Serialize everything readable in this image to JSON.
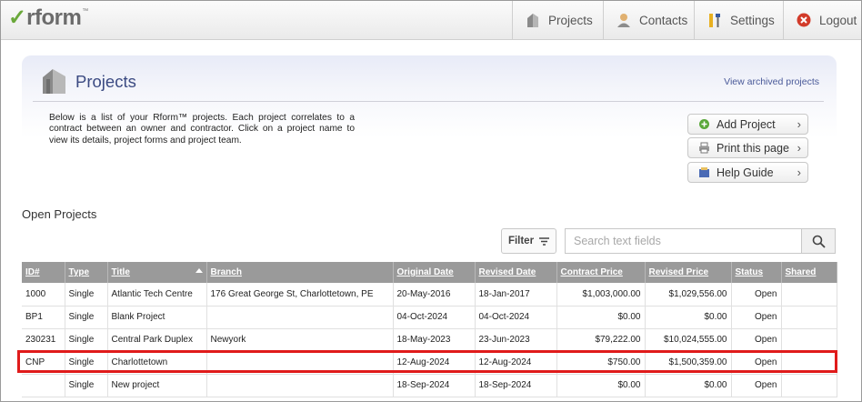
{
  "app": {
    "logo_text": "rform",
    "logo_tm": "™",
    "brand_check_color": "#6aa83a"
  },
  "nav": {
    "projects": "Projects",
    "contacts": "Contacts",
    "settings": "Settings",
    "logout": "Logout"
  },
  "header": {
    "title": "Projects",
    "archived_link": "View archived projects",
    "intro": "Below is a list of your Rform™ projects. Each project correlates to a contract between an owner and contractor. Click on a project name to view its details, project forms and project team."
  },
  "actions": {
    "add_project": "Add Project",
    "print_page": "Print this page",
    "help_guide": "Help Guide"
  },
  "open_projects": {
    "title": "Open Projects",
    "filter_label": "Filter",
    "search_placeholder": "Search text fields"
  },
  "table": {
    "columns": [
      "ID#",
      "Type",
      "Title",
      "Branch",
      "Original Date",
      "Revised Date",
      "Contract Price",
      "Revised Price",
      "Status",
      "Shared"
    ],
    "sorted_column": "Title",
    "rows": [
      [
        "1000",
        "Single",
        "Atlantic Tech Centre",
        "176 Great George St, Charlottetown, PE",
        "20-May-2016",
        "18-Jan-2017",
        "$1,003,000.00",
        "$1,029,556.00",
        "Open",
        ""
      ],
      [
        "BP1",
        "Single",
        "Blank Project",
        "",
        "04-Oct-2024",
        "04-Oct-2024",
        "$0.00",
        "$0.00",
        "Open",
        ""
      ],
      [
        "230231",
        "Single",
        "Central Park Duplex",
        "Newyork",
        "18-May-2023",
        "23-Jun-2023",
        "$79,222.00",
        "$10,024,555.00",
        "Open",
        ""
      ],
      [
        "CNP",
        "Single",
        "Charlottetown",
        "",
        "12-Aug-2024",
        "12-Aug-2024",
        "$750.00",
        "$1,500,359.00",
        "Open",
        ""
      ],
      [
        "",
        "Single",
        "New project",
        "",
        "18-Sep-2024",
        "18-Sep-2024",
        "$0.00",
        "$0.00",
        "Open",
        ""
      ]
    ],
    "highlighted_row_index": 3,
    "highlight_color": "#e01b1b"
  }
}
